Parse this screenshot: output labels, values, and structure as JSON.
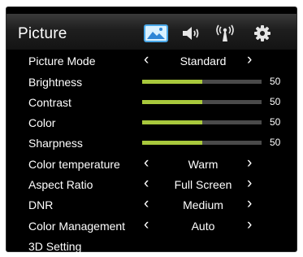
{
  "menu": {
    "title": "Picture",
    "tabs": [
      {
        "name": "picture",
        "icon": "picture-icon",
        "active": true
      },
      {
        "name": "sound",
        "icon": "speaker-icon",
        "active": false
      },
      {
        "name": "network",
        "icon": "antenna-icon",
        "active": false
      },
      {
        "name": "settings",
        "icon": "gear-icon",
        "active": false
      }
    ],
    "accent_color": "#a8c83c",
    "items": [
      {
        "label": "Picture Mode",
        "type": "selector",
        "value": "Standard"
      },
      {
        "label": "Brightness",
        "type": "slider",
        "value": "50",
        "level": 0.5
      },
      {
        "label": "Contrast",
        "type": "slider",
        "value": "50",
        "level": 0.5
      },
      {
        "label": "Color",
        "type": "slider",
        "value": "50",
        "level": 0.5
      },
      {
        "label": "Sharpness",
        "type": "slider",
        "value": "50",
        "level": 0.5
      },
      {
        "label": "Color temperature",
        "type": "selector",
        "value": "Warm"
      },
      {
        "label": "Aspect Ratio",
        "type": "selector",
        "value": "Full Screen"
      },
      {
        "label": "DNR",
        "type": "selector",
        "value": "Medium"
      },
      {
        "label": "Color Management",
        "type": "selector",
        "value": "Auto"
      },
      {
        "label": "3D Setting",
        "type": "submenu"
      }
    ]
  }
}
